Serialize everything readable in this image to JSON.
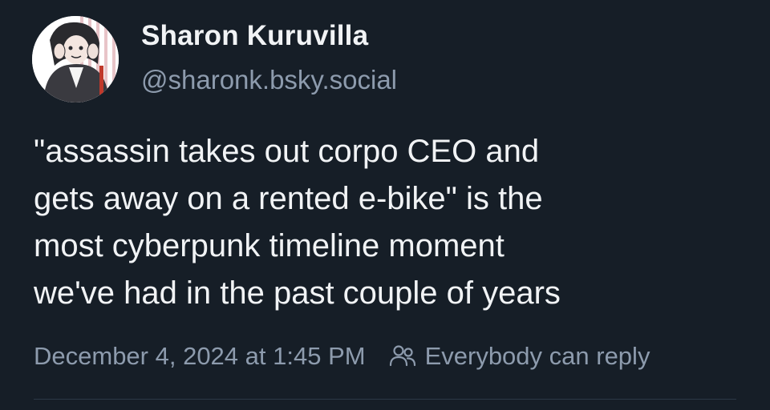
{
  "author": {
    "display_name": "Sharon Kuruvilla",
    "handle": "@sharonk.bsky.social"
  },
  "post": {
    "text_lines": [
      "\"assassin takes out corpo CEO and",
      "gets away on a rented e-bike\" is the",
      "most cyberpunk timeline moment",
      "we've had in the past couple of years"
    ],
    "timestamp": "December 4, 2024 at 1:45 PM",
    "reply_setting": "Everybody can reply",
    "reply_icon": "people-icon"
  },
  "colors": {
    "background": "#161e27",
    "primary_text": "#f1f3f5",
    "secondary_text": "#8d9bad"
  }
}
